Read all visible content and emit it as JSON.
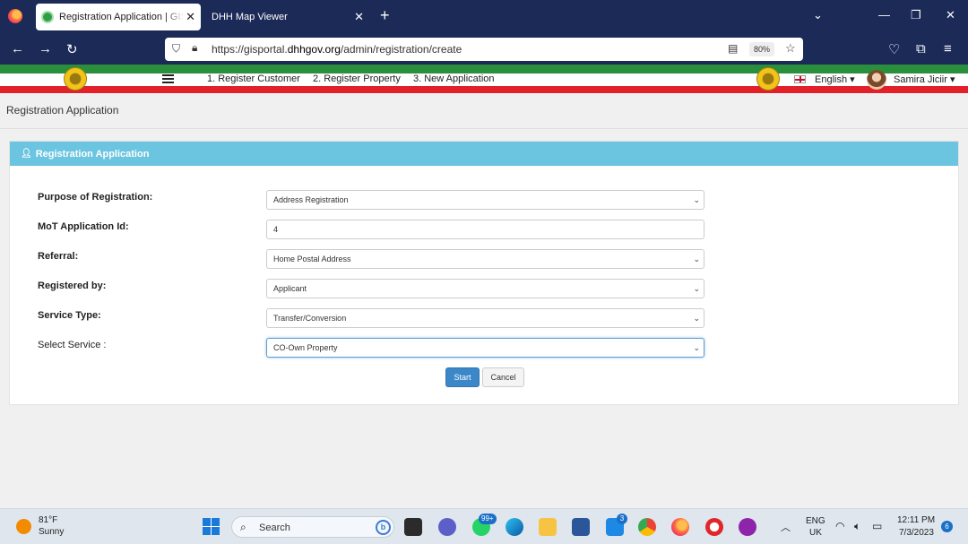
{
  "browser": {
    "tabs": [
      {
        "title": "Registration Application | GIS Portal",
        "close": "✕"
      },
      {
        "title": "DHH Map Viewer",
        "close": "✕"
      }
    ],
    "new_tab": "+",
    "url_prefix": "https://gisportal.",
    "url_domain": "dhhgov.org",
    "url_path": "/admin/registration/create",
    "zoom": "80%"
  },
  "header": {
    "menu": [
      "1. Register Customer",
      "2. Register Property",
      "3. New Application"
    ],
    "language": "English",
    "user": "Samira Jiciir"
  },
  "page": {
    "title": "Registration Application",
    "panel_title": "Registration Application"
  },
  "form": {
    "fields": [
      {
        "label": "Purpose of Registration:",
        "value": "Address Registration"
      },
      {
        "label": "MoT Application Id:",
        "value": "4"
      },
      {
        "label": "Referral:",
        "value": "Home Postal Address"
      },
      {
        "label": "Registered by:",
        "value": "Applicant"
      },
      {
        "label": "Service Type:",
        "value": "Transfer/Conversion"
      },
      {
        "label": "Select Service :",
        "value": "CO-Own Property"
      }
    ],
    "start_label": "Start",
    "cancel_label": "Cancel"
  },
  "taskbar": {
    "temperature": "81°F",
    "condition": "Sunny",
    "search": "Search",
    "whatsapp_badge": "99+",
    "mail_badge": "3",
    "lang_line1": "ENG",
    "lang_line2": "UK",
    "time": "12:11 PM",
    "date": "7/3/2023",
    "notifications": "6"
  },
  "colors": {
    "browser_chrome": "#1c2a58",
    "panel_header": "#6bc4e0",
    "flag_green": "#2a8f3c",
    "flag_red": "#e1202a",
    "primary_button": "#3b87c8"
  }
}
